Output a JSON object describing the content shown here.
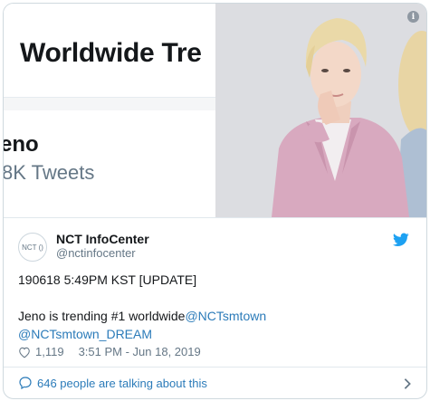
{
  "media": {
    "trend_title": "Worldwide Tre",
    "trend_name": "eno",
    "trend_count": "8K Tweets",
    "info_label": "i"
  },
  "tweet": {
    "display_name": "NCT InfoCenter",
    "handle": "@nctinfocenter",
    "avatar_text": "NCT ()",
    "line1": "190618 5:49PM KST [UPDATE]",
    "line2_text": "Jeno is trending #1 worldwide",
    "mention1": "@NCTsmtown",
    "mention2": "@NCTsmtown_DREAM",
    "likes": "1,119",
    "timestamp": "3:51 PM - Jun 18, 2019"
  },
  "footer": {
    "talking": "646 people are talking about this"
  },
  "colors": {
    "link": "#2b7bb9",
    "twitter_blue": "#1da1f2",
    "muted": "#657786"
  },
  "icons": [
    "info-icon",
    "twitter-bird-icon",
    "heart-icon",
    "speech-bubble-icon",
    "chevron-right-icon"
  ]
}
